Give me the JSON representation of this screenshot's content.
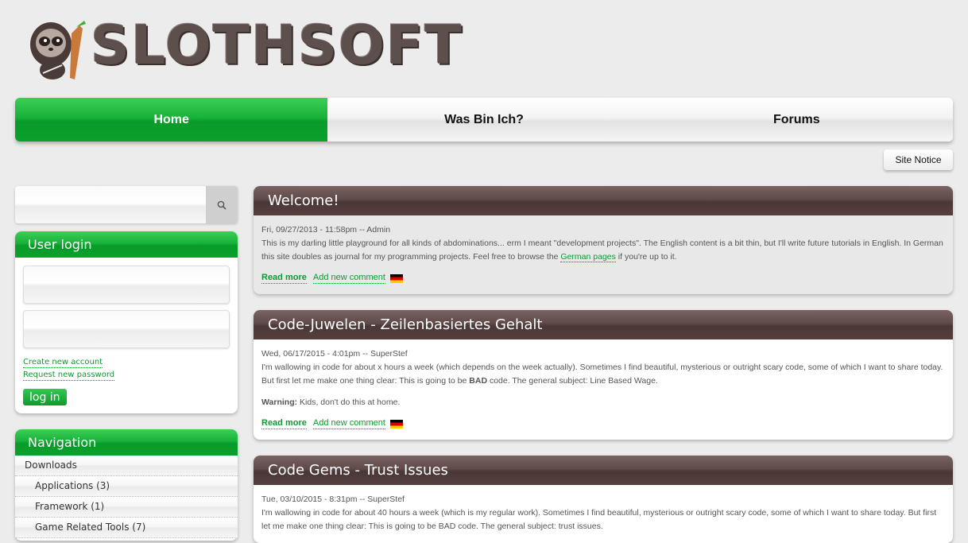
{
  "header": {
    "logo_text": "SLOTHSOFT",
    "mascot": "sloth-mascot-icon"
  },
  "mainnav": {
    "tabs": [
      {
        "label": "Home",
        "active": true
      },
      {
        "label": "Was Bin Ich?",
        "active": false
      },
      {
        "label": "Forums",
        "active": false
      }
    ]
  },
  "site_notice": "Site Notice",
  "search": {
    "placeholder": "",
    "icon": "search-icon"
  },
  "user_login": {
    "title": "User login",
    "create_account": "Create new account",
    "request_password": "Request new password",
    "login_button": "log in"
  },
  "navigation": {
    "title": "Navigation",
    "items": [
      {
        "label": "Downloads",
        "level": 1
      },
      {
        "label": "Applications (3)",
        "level": 2
      },
      {
        "label": "Framework (1)",
        "level": 2
      },
      {
        "label": "Game Related Tools (7)",
        "level": 2
      }
    ]
  },
  "nodes": [
    {
      "title": "Welcome!",
      "meta": "Fri, 09/27/2013 - 11:58pm -- Admin",
      "body_before_link": "This is my darling little playground for all kinds of abdominations... erm I meant \"development projects\". The English content is a bit thin, but I'll write future tutorials in English. In German this site doubles as journal for my programming projects. Feel free to browse the ",
      "body_link": "German pages",
      "body_after_link": " if you're up to it.",
      "read_more": "Read more",
      "add_comment": "Add new comment",
      "flag": "german-flag-icon"
    },
    {
      "title": "Code-Juwelen - Zeilenbasiertes Gehalt",
      "meta": "Wed, 06/17/2015 - 4:01pm -- SuperStef",
      "body_before_bold": "I'm wallowing in code for about x hours a week (which depends on the week actually). Sometimes I find beautiful, mysterious or outright scary code, some of which I want to share today. But first let me make one thing clear: This is going to be ",
      "body_bold": "BAD",
      "body_after_bold": " code. The general subject: Line Based Wage.",
      "warning_label": "Warning:",
      "warning_text": " Kids, don't do this at home.",
      "read_more": "Read more",
      "add_comment": "Add new comment",
      "flag": "german-flag-icon"
    },
    {
      "title": "Code Gems - Trust Issues",
      "meta": "Tue, 03/10/2015 - 8:31pm -- SuperStef",
      "body": "I'm wallowing in code for about 40 hours a week (which is my regular work). Sometimes I find beautiful, mysterious or outright scary code, some of which I want to share today. But first let me make one thing clear: This is going to be BAD code. The general subject: trust issues."
    }
  ]
}
